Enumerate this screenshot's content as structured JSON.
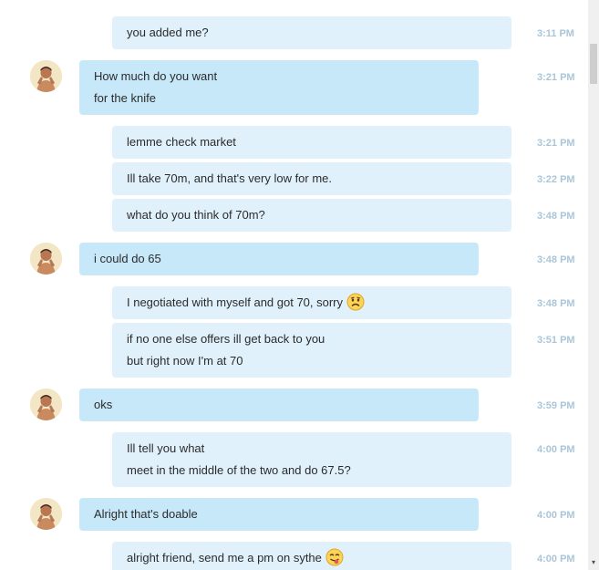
{
  "messages": [
    {
      "sender": "me",
      "lines": [
        "you added me?"
      ],
      "time": "3:11 PM"
    },
    {
      "sender": "contact",
      "lines": [
        "How much do you want",
        "for the knife"
      ],
      "time": "3:21 PM"
    },
    {
      "sender": "me",
      "lines": [
        "lemme check market"
      ],
      "time": "3:21 PM"
    },
    {
      "sender": "me",
      "lines": [
        "Ill take 70m, and that's very low for me."
      ],
      "time": "3:22 PM"
    },
    {
      "sender": "me",
      "lines": [
        "what do you think of 70m?"
      ],
      "time": "3:48 PM"
    },
    {
      "sender": "contact",
      "lines": [
        "i could do 65"
      ],
      "time": "3:48 PM"
    },
    {
      "sender": "me",
      "lines": [
        "I negotiated with myself and got 70, sorry"
      ],
      "emoji": "sad-face-emoji",
      "time": "3:48 PM"
    },
    {
      "sender": "me",
      "lines": [
        "if no one else offers ill get back to you",
        "but right now I'm at 70"
      ],
      "time": "3:51 PM"
    },
    {
      "sender": "contact",
      "lines": [
        "oks"
      ],
      "time": "3:59 PM"
    },
    {
      "sender": "me",
      "lines": [
        "Ill tell you what",
        "meet in the middle of the two and do 67.5?"
      ],
      "time": "4:00 PM"
    },
    {
      "sender": "contact",
      "lines": [
        "Alright that's doable"
      ],
      "time": "4:00 PM"
    },
    {
      "sender": "me",
      "lines": [
        "alright friend, send me a pm on sythe"
      ],
      "emoji": "tongue-out-emoji",
      "time": "4:00 PM"
    }
  ],
  "colors": {
    "outgoing_bubble": "#e0f1fb",
    "incoming_bubble": "#c7e8f9",
    "timestamp": "#a9c6d8"
  },
  "icons": {
    "scroll_down": "▾"
  }
}
